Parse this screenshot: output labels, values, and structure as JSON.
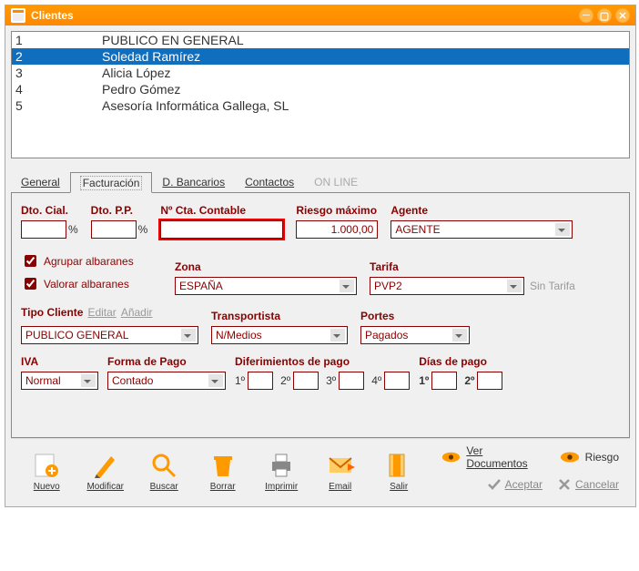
{
  "window": {
    "title": "Clientes"
  },
  "list": {
    "rows": [
      {
        "id": "1",
        "name": "PUBLICO EN GENERAL",
        "selected": false
      },
      {
        "id": "2",
        "name": "Soledad Ramírez",
        "selected": true
      },
      {
        "id": "3",
        "name": "Alicia López",
        "selected": false
      },
      {
        "id": "4",
        "name": "Pedro Gómez",
        "selected": false
      },
      {
        "id": "5",
        "name": "Asesoría Informática Gallega, SL",
        "selected": false
      }
    ]
  },
  "tabs": {
    "general": "General",
    "facturacion": "Facturación",
    "dbancarios": "D. Bancarios",
    "contactos": "Contactos",
    "online": "ON LINE"
  },
  "labels": {
    "dto_cial": "Dto. Cial.",
    "dto_pp": "Dto. P.P.",
    "ncta": "Nº Cta. Contable",
    "riesgo_max": "Riesgo máximo",
    "agente": "Agente",
    "agrupar": "Agrupar albaranes",
    "valorar": "Valorar albaranes",
    "zona": "Zona",
    "tarifa": "Tarifa",
    "sin_tarifa": "Sin Tarifa",
    "tipo_cliente": "Tipo Cliente",
    "editar": "Editar",
    "anadir": "Añadir",
    "transportista": "Transportista",
    "portes": "Portes",
    "iva": "IVA",
    "forma_pago": "Forma de Pago",
    "difer": "Diferimientos de pago",
    "dias_pago": "Días de pago",
    "d1": "1º",
    "d2": "2º",
    "d3": "3º",
    "d4": "4º"
  },
  "values": {
    "dto_cial": "",
    "dto_pp": "",
    "ncta": "",
    "riesgo_max": "1.000,00",
    "agente": "AGENTE",
    "agrupar": true,
    "valorar": true,
    "zona": "ESPAÑA",
    "tarifa": "PVP2",
    "tipo_cliente": "PUBLICO GENERAL",
    "transportista": "N/Medios",
    "portes": "Pagados",
    "iva": "Normal",
    "forma_pago": "Contado",
    "dif1": "",
    "dif2": "",
    "dif3": "",
    "dif4": "",
    "dia1": "",
    "dia2": ""
  },
  "toolbar": {
    "nuevo": "Nuevo",
    "modificar": "Modificar",
    "buscar": "Buscar",
    "borrar": "Borrar",
    "imprimir": "Imprimir",
    "email": "Email",
    "salir": "Salir",
    "ver_doc": "Ver Documentos",
    "riesgo": "Riesgo",
    "aceptar": "Aceptar",
    "cancelar": "Cancelar"
  }
}
